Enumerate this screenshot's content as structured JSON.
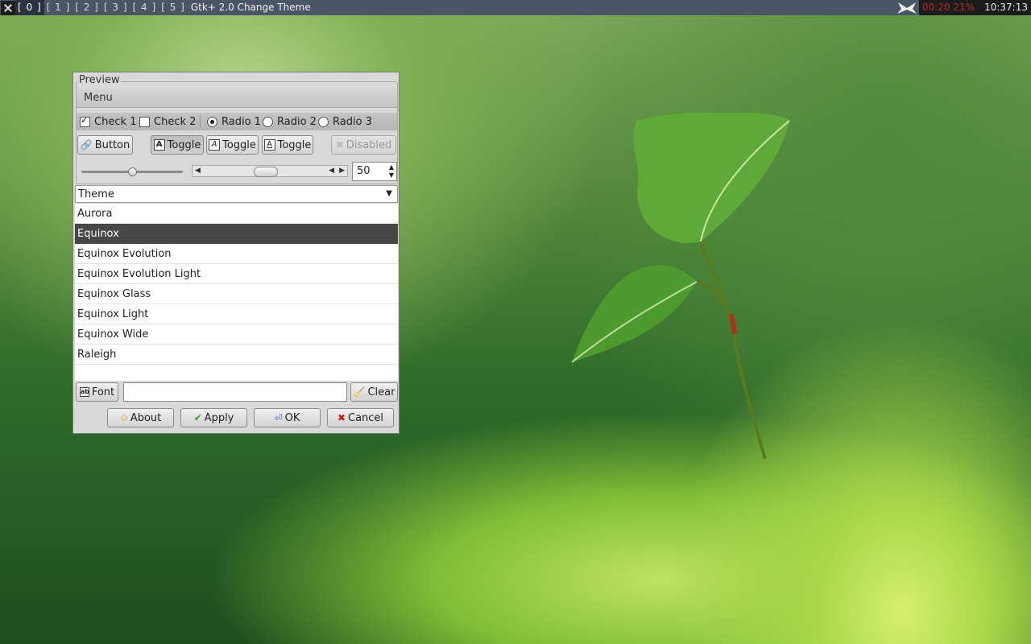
{
  "topbar": {
    "workspaces": [
      "[ 0 ]",
      "[ 1 ]",
      "[ 2 ]",
      "[ 3 ]",
      "[ 4 ]",
      "[ 5 ]"
    ],
    "active_workspace": 0,
    "window_title": "Gtk+ 2.0 Change Theme",
    "status": "00:20 21%",
    "clock": "10:37:13"
  },
  "preview": {
    "legend": "Preview",
    "menu_label": "Menu",
    "checks": [
      {
        "label": "Check 1",
        "checked": true
      },
      {
        "label": "Check 2",
        "checked": false
      }
    ],
    "radios": [
      {
        "label": "Radio 1",
        "selected": true
      },
      {
        "label": "Radio 2",
        "selected": false
      },
      {
        "label": "Radio 3",
        "selected": false
      }
    ],
    "button_label": "Button",
    "toggles": [
      "Toggle",
      "Toggle",
      "Toggle"
    ],
    "disabled_label": "Disabled",
    "spin_value": "50",
    "slider_fraction": 0.5,
    "scroll_fraction": 0.5
  },
  "theme": {
    "combo_label": "Theme",
    "items": [
      "Aurora",
      "Equinox",
      "Equinox Evolution",
      "Equinox Evolution Light",
      "Equinox Glass",
      "Equinox Light",
      "Equinox Wide",
      "Raleigh"
    ],
    "selected": "Equinox"
  },
  "font_row": {
    "font_label": "Font",
    "entry_value": "",
    "clear_label": "Clear"
  },
  "actions": {
    "about": "About",
    "apply": "Apply",
    "ok": "OK",
    "cancel": "Cancel"
  }
}
